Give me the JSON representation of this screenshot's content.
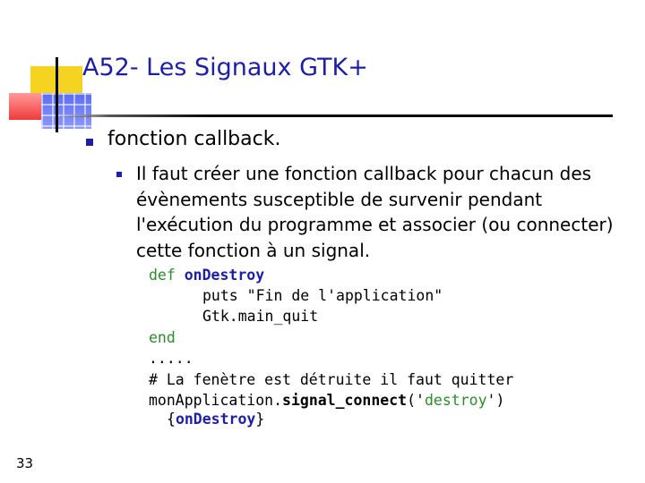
{
  "slide": {
    "title": "A52- Les Signaux GTK+",
    "page_number": "33"
  },
  "bullets": {
    "level1": "fonction callback.",
    "level2": "Il faut créer une fonction callback pour chacun des évènements susceptible de survenir pendant l'exécution du programme et associer (ou connecter) cette fonction à un signal."
  },
  "code": {
    "def_kw": "def",
    "func_name": "onDestroy",
    "line2": "puts \"Fin de l'application\"",
    "line3": "Gtk.main_quit",
    "end_kw": "end",
    "dots": ".....",
    "comment": "# La fenètre est détruite il faut quitter",
    "obj": "monApplication.",
    "method": "signal_connect",
    "paren_open": "('",
    "signal": "destroy",
    "paren_close": "')",
    "brace_open": "{",
    "handler": "onDestroy",
    "brace_close": "}"
  },
  "colors": {
    "title": "#1f1fa6",
    "keyword": "#2e8b2e",
    "accent_yellow": "#f5d321",
    "accent_red": "#f03a3a",
    "accent_blue": "#5c6cf2"
  }
}
